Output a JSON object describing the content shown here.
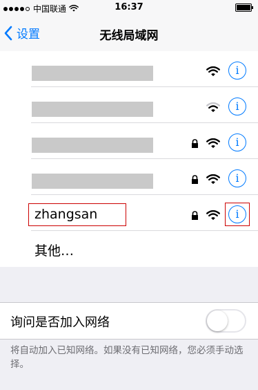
{
  "status_bar": {
    "carrier": "中国联通",
    "time": "16:37"
  },
  "nav": {
    "back_label": "设置",
    "title": "无线局域网"
  },
  "networks": [
    {
      "name": "",
      "redacted": true,
      "locked": false,
      "wifi_strength": "full",
      "info_icon": "i"
    },
    {
      "name": "",
      "redacted": true,
      "locked": false,
      "wifi_strength": "weak",
      "info_icon": "i"
    },
    {
      "name": "",
      "redacted": true,
      "locked": true,
      "wifi_strength": "full",
      "info_icon": "i"
    },
    {
      "name": "",
      "redacted": true,
      "locked": true,
      "wifi_strength": "full",
      "info_icon": "i"
    },
    {
      "name": "zhangsan",
      "redacted": false,
      "locked": true,
      "wifi_strength": "full",
      "info_icon": "i",
      "highlighted": true
    }
  ],
  "other_label": "其他…",
  "ask_to_join": {
    "label": "询问是否加入网络",
    "enabled": false
  },
  "footnote": "将自动加入已知网络。如果没有已知网络，您必须手动选择。",
  "colors": {
    "accent": "#007aff",
    "highlight": "#cc0000"
  }
}
